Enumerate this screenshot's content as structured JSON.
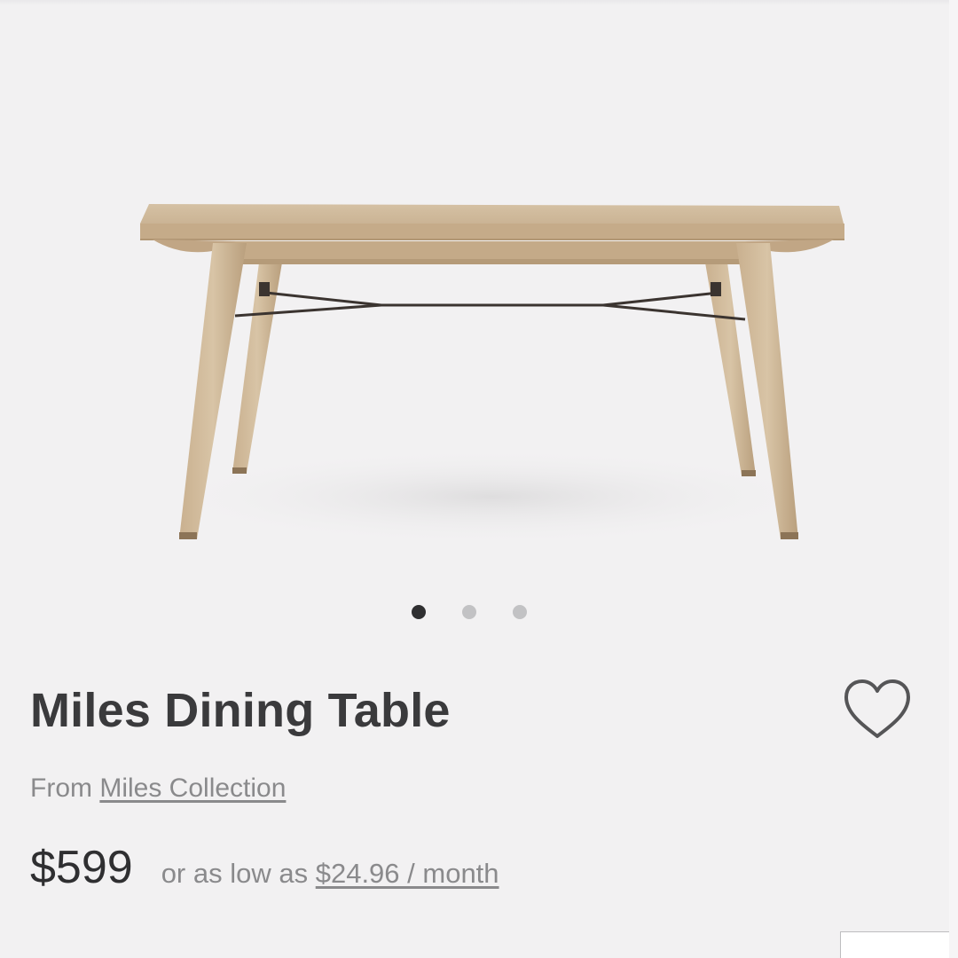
{
  "product": {
    "image_alt": "Miles Dining Table",
    "title": "Miles Dining Table",
    "collection_prefix": "From",
    "collection_link": "Miles Collection",
    "price": "$599",
    "financing_prefix": "or as low as",
    "financing_link": "$24.96 / month"
  },
  "carousel": {
    "count": 3,
    "active_index": 0
  },
  "icons": {
    "favorite": "heart-outline-icon"
  },
  "colors": {
    "background": "#f2f1f2",
    "text_primary": "#3a3a3c",
    "text_secondary": "#8a8a8c",
    "dot_active": "#2f2f31",
    "dot_inactive": "#c2c2c4",
    "wood": "#c9b394"
  }
}
